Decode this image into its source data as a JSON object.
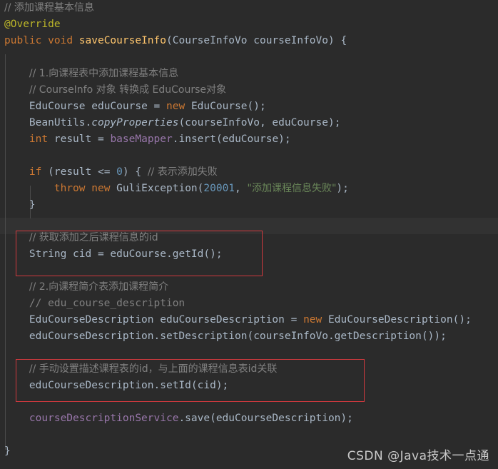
{
  "editor": {
    "theme_name": "darcula",
    "background_color": "#2b2b2b",
    "caret_line_color": "#323232",
    "gutter_guide_color": "#4b4b4b",
    "language": "java"
  },
  "colors": {
    "comment": "#808080",
    "keyword": "#cc7832",
    "annotation": "#bbb529",
    "method_declaration": "#ffc66d",
    "identifier": "#a9b7c6",
    "field": "#9876aa",
    "number": "#6897bb",
    "string": "#6a8759",
    "highlight_box": "#d0393e",
    "watermark": "#c9c9c9"
  },
  "code_lines": [
    {
      "n": 1,
      "text": "// 添加课程基本信息"
    },
    {
      "n": 2,
      "text": "@Override"
    },
    {
      "n": 3,
      "text": "public void saveCourseInfo(CourseInfoVo courseInfoVo) {"
    },
    {
      "n": 4,
      "text": ""
    },
    {
      "n": 5,
      "text": "    // 1.向课程表中添加课程基本信息"
    },
    {
      "n": 6,
      "text": "    // CourseInfo 对象 转换成 EduCourse对象"
    },
    {
      "n": 7,
      "text": "    EduCourse eduCourse = new EduCourse();"
    },
    {
      "n": 8,
      "text": "    BeanUtils.copyProperties(courseInfoVo, eduCourse);"
    },
    {
      "n": 9,
      "text": "    int result = baseMapper.insert(eduCourse);"
    },
    {
      "n": 10,
      "text": ""
    },
    {
      "n": 11,
      "text": "    if (result <= 0) { // 表示添加失败"
    },
    {
      "n": 12,
      "text": "        throw new GuliException(20001, \"添加课程信息失败\");"
    },
    {
      "n": 13,
      "text": "    }"
    },
    {
      "n": 14,
      "text": ""
    },
    {
      "n": 15,
      "text": "    // 获取添加之后课程信息的id"
    },
    {
      "n": 16,
      "text": "    String cid = eduCourse.getId();"
    },
    {
      "n": 17,
      "text": ""
    },
    {
      "n": 18,
      "text": "    // 2.向课程简介表添加课程简介"
    },
    {
      "n": 19,
      "text": "    // edu_course_description"
    },
    {
      "n": 20,
      "text": "    EduCourseDescription eduCourseDescription = new EduCourseDescription();"
    },
    {
      "n": 21,
      "text": "    eduCourseDescription.setDescription(courseInfoVo.getDescription());"
    },
    {
      "n": 22,
      "text": ""
    },
    {
      "n": 23,
      "text": "    // 手动设置描述课程表的id，与上面的课程信息表id关联"
    },
    {
      "n": 24,
      "text": "    eduCourseDescription.setId(cid);"
    },
    {
      "n": 25,
      "text": ""
    },
    {
      "n": 26,
      "text": "    courseDescriptionService.save(eduCourseDescription);"
    },
    {
      "n": 27,
      "text": ""
    },
    {
      "n": 28,
      "text": "}"
    }
  ],
  "tokens": {
    "l1_comment": "// 添加课程基本信息",
    "l2_annotation": "@Override",
    "l3_public": "public",
    "l3_void": "void",
    "l3_method": "saveCourseInfo",
    "l3_paren_open": "(",
    "l3_type": "CourseInfoVo",
    "l3_param": "courseInfoVo",
    "l3_tail": ") {",
    "l5_comment": "// 1.向课程表中添加课程基本信息",
    "l6_comment": "// CourseInfo 对象 转换成 EduCourse对象",
    "l7_type": "EduCourse",
    "l7_var": "eduCourse",
    "l7_eq": "=",
    "l7_new": "new",
    "l7_ctor": "EduCourse();",
    "l8_class": "BeanUtils",
    "l8_dot": ".",
    "l8_static_method": "copyProperties",
    "l8_args": "(courseInfoVo, eduCourse);",
    "l9_int": "int",
    "l9_var": "result",
    "l9_eq": "=",
    "l9_field": "baseMapper",
    "l9_call": ".insert(eduCourse);",
    "l11_if": "if",
    "l11_cond_a": "(result <= ",
    "l11_zero": "0",
    "l11_cond_b": ") { ",
    "l11_comment": "// 表示添加失败",
    "l12_throw": "throw",
    "l12_new": "new",
    "l12_exception": "GuliException(",
    "l12_code": "20001",
    "l12_comma": ", ",
    "l12_string": "\"添加课程信息失败\"",
    "l12_tail": ");",
    "l13_brace": "}",
    "l15_comment": "// 获取添加之后课程信息的id",
    "l16_type": "String",
    "l16_rest": "cid = eduCourse.getId();",
    "l18_comment": "// 2.向课程简介表添加课程简介",
    "l19_comment": "// edu_course_description",
    "l20_type": "EduCourseDescription",
    "l20_var": "eduCourseDescription",
    "l20_eq": "=",
    "l20_new": "new",
    "l20_ctor": "EduCourseDescription();",
    "l21_text": "eduCourseDescription.setDescription(courseInfoVo.getDescription());",
    "l23_comment": "// 手动设置描述课程表的id，与上面的课程信息表id关联",
    "l24_text": "eduCourseDescription.setId(cid);",
    "l26_field": "courseDescriptionService",
    "l26_call": ".save(eduCourseDescription);",
    "l28_brace": "}"
  },
  "annotations": {
    "box_1_label": "highlight-get-id",
    "box_2_label": "highlight-set-id"
  },
  "watermark": {
    "text": "CSDN @Java技术一点通"
  }
}
